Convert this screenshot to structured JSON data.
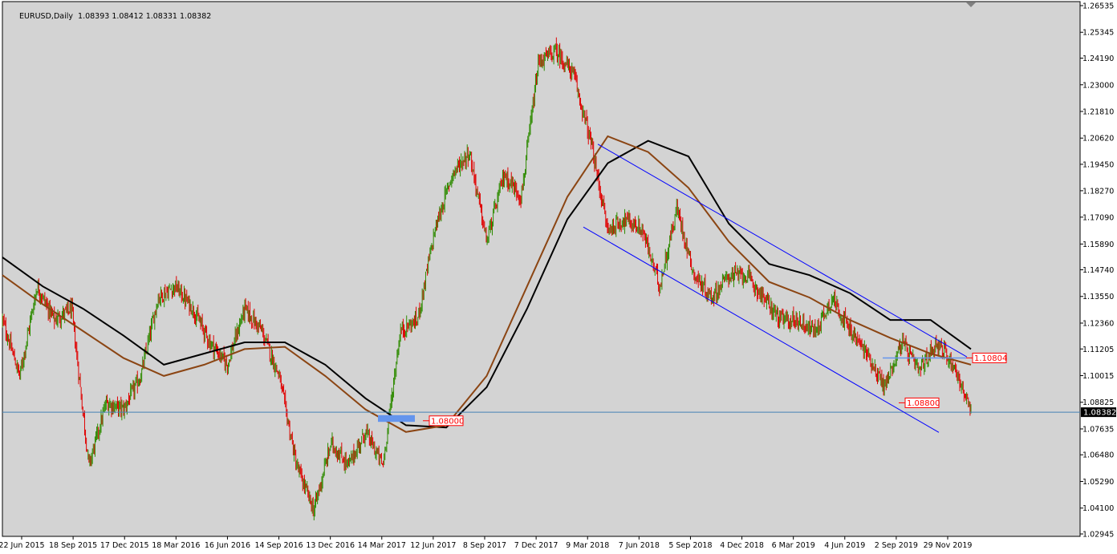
{
  "chart_data": {
    "type": "candlestick",
    "symbol": "EURUSD",
    "timeframe": "Daily",
    "ohlc": {
      "open": "1.08393",
      "high": "1.08412",
      "low": "1.08331",
      "close": "1.08382"
    },
    "ylim": [
      1.02945,
      1.26535
    ],
    "y_ticks": [
      "1.26535",
      "1.25345",
      "1.24190",
      "1.23000",
      "1.21810",
      "1.20620",
      "1.19450",
      "1.18270",
      "1.17090",
      "1.15890",
      "1.14740",
      "1.13550",
      "1.12360",
      "1.11205",
      "1.10015",
      "1.08825",
      "1.07635",
      "1.06480",
      "1.05290",
      "1.04100",
      "1.02945"
    ],
    "x_ticks": [
      "22 Jun 2015",
      "18 Sep 2015",
      "17 Dec 2015",
      "18 Mar 2016",
      "16 Jun 2016",
      "14 Sep 2016",
      "13 Dec 2016",
      "14 Mar 2017",
      "12 Jun 2017",
      "8 Sep 2017",
      "7 Dec 2017",
      "9 Mar 2018",
      "7 Jun 2018",
      "5 Sep 2018",
      "4 Dec 2018",
      "6 Mar 2019",
      "4 Jun 2019",
      "2 Sep 2019",
      "29 Nov 2019"
    ],
    "price_path": [
      {
        "date": "22 Jun 2015",
        "price": 1.125
      },
      {
        "date": "Jul 2015",
        "price": 1.1
      },
      {
        "date": "Aug 2015",
        "price": 1.14
      },
      {
        "date": "Sep 2015",
        "price": 1.125
      },
      {
        "date": "Oct 2015",
        "price": 1.13
      },
      {
        "date": "Nov 2015",
        "price": 1.06
      },
      {
        "date": "Dec 2015",
        "price": 1.088
      },
      {
        "date": "Jan 2016",
        "price": 1.085
      },
      {
        "date": "Feb 2016",
        "price": 1.1
      },
      {
        "date": "Mar 2016",
        "price": 1.135
      },
      {
        "date": "Apr 2016",
        "price": 1.14
      },
      {
        "date": "May 2016",
        "price": 1.13
      },
      {
        "date": "Jun 2016",
        "price": 1.115
      },
      {
        "date": "Jul 2016",
        "price": 1.105
      },
      {
        "date": "Aug 2016",
        "price": 1.13
      },
      {
        "date": "Sep 2016",
        "price": 1.12
      },
      {
        "date": "Oct 2016",
        "price": 1.1
      },
      {
        "date": "Nov 2016",
        "price": 1.06
      },
      {
        "date": "Dec 2016",
        "price": 1.04
      },
      {
        "date": "Jan 2017",
        "price": 1.07
      },
      {
        "date": "Feb 2017",
        "price": 1.06
      },
      {
        "date": "Mar 2017",
        "price": 1.075
      },
      {
        "date": "Apr 2017",
        "price": 1.06
      },
      {
        "date": "May 2017",
        "price": 1.12
      },
      {
        "date": "Jun 2017",
        "price": 1.125
      },
      {
        "date": "Jul 2017",
        "price": 1.165
      },
      {
        "date": "Aug 2017",
        "price": 1.19
      },
      {
        "date": "Sep 2017",
        "price": 1.2
      },
      {
        "date": "Oct 2017",
        "price": 1.16
      },
      {
        "date": "Nov 2017",
        "price": 1.19
      },
      {
        "date": "Dec 2017",
        "price": 1.18
      },
      {
        "date": "Jan 2018",
        "price": 1.24
      },
      {
        "date": "Feb 2018",
        "price": 1.245
      },
      {
        "date": "Mar 2018",
        "price": 1.235
      },
      {
        "date": "Apr 2018",
        "price": 1.205
      },
      {
        "date": "May 2018",
        "price": 1.165
      },
      {
        "date": "Jun 2018",
        "price": 1.17
      },
      {
        "date": "Jul 2018",
        "price": 1.165
      },
      {
        "date": "Aug 2018",
        "price": 1.14
      },
      {
        "date": "Sep 2018",
        "price": 1.175
      },
      {
        "date": "Oct 2018",
        "price": 1.145
      },
      {
        "date": "Nov 2018",
        "price": 1.135
      },
      {
        "date": "Dec 2018",
        "price": 1.145
      },
      {
        "date": "Jan 2019",
        "price": 1.145
      },
      {
        "date": "Feb 2019",
        "price": 1.135
      },
      {
        "date": "Mar 2019",
        "price": 1.125
      },
      {
        "date": "Apr 2019",
        "price": 1.125
      },
      {
        "date": "May 2019",
        "price": 1.12
      },
      {
        "date": "Jun 2019",
        "price": 1.135
      },
      {
        "date": "Jul 2019",
        "price": 1.12
      },
      {
        "date": "Aug 2019",
        "price": 1.11
      },
      {
        "date": "Sep 2019",
        "price": 1.095
      },
      {
        "date": "Oct 2019",
        "price": 1.115
      },
      {
        "date": "Nov 2019",
        "price": 1.102
      },
      {
        "date": "Dec 2019",
        "price": 1.115
      },
      {
        "date": "Jan 2020",
        "price": 1.105
      },
      {
        "date": "Feb 2020",
        "price": 1.0838
      }
    ],
    "moving_averages": [
      {
        "color": "#000000",
        "path": [
          1.153,
          1.14,
          1.13,
          1.118,
          1.105,
          1.11,
          1.115,
          1.115,
          1.105,
          1.09,
          1.078,
          1.077,
          1.095,
          1.13,
          1.17,
          1.195,
          1.205,
          1.198,
          1.168,
          1.15,
          1.145,
          1.137,
          1.125,
          1.125,
          1.112
        ]
      },
      {
        "color": "#8b4513",
        "path": [
          1.145,
          1.132,
          1.12,
          1.108,
          1.1,
          1.105,
          1.112,
          1.113,
          1.1,
          1.085,
          1.075,
          1.078,
          1.1,
          1.14,
          1.18,
          1.207,
          1.2,
          1.184,
          1.16,
          1.142,
          1.135,
          1.125,
          1.117,
          1.11,
          1.105
        ]
      }
    ],
    "annotations": [
      {
        "label": "1.08000",
        "price": 1.08
      },
      {
        "label": "1.08800",
        "price": 1.088
      },
      {
        "label": "1.10804",
        "price": 1.10804
      }
    ],
    "current_price": {
      "label": "1.08382",
      "price": 1.08382
    },
    "colors": {
      "bull": "#2e8b00",
      "bear": "#e00000",
      "channel": "#0000ff",
      "support_zone": "#6495ed",
      "annotation": "#ff0000",
      "background": "#ffffff",
      "plot": "#d3d3d3"
    }
  }
}
